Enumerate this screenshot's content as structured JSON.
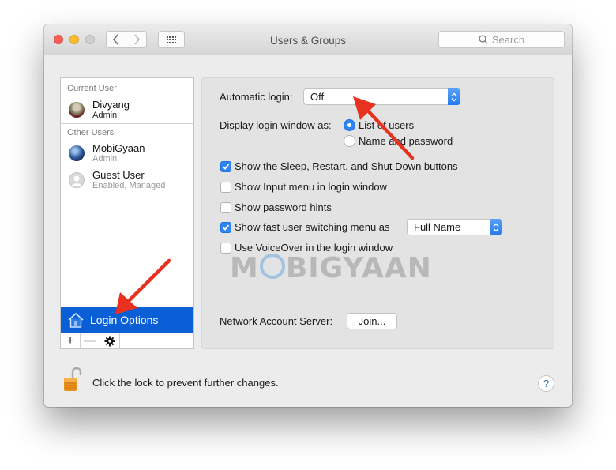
{
  "window": {
    "title": "Users & Groups",
    "search_placeholder": "Search",
    "icons": {
      "close": "close-icon",
      "minimize": "minimize-icon",
      "zoom": "zoom-icon",
      "back": "chevron-left-icon",
      "forward": "chevron-right-icon",
      "show_all": "grid-icon",
      "search": "search-icon"
    }
  },
  "sidebar": {
    "current_user_header": "Current User",
    "other_users_header": "Other Users",
    "current_user": {
      "name": "Divyang",
      "role": "Admin"
    },
    "other_users": [
      {
        "name": "MobiGyaan",
        "role": "Admin"
      },
      {
        "name": "Guest User",
        "role": "Enabled, Managed"
      }
    ],
    "login_options_label": "Login Options",
    "toolbar": {
      "add": "+",
      "remove": "—",
      "settings": "gear-icon"
    }
  },
  "login_options": {
    "automatic_login_label": "Automatic login:",
    "automatic_login_value": "Off",
    "display_login_label": "Display login window as:",
    "display_options": [
      {
        "label": "List of users",
        "selected": true
      },
      {
        "label": "Name and password",
        "selected": false
      }
    ],
    "checkboxes": [
      {
        "label": "Show the Sleep, Restart, and Shut Down buttons",
        "checked": true
      },
      {
        "label": "Show Input menu in login window",
        "checked": false
      },
      {
        "label": "Show password hints",
        "checked": false
      },
      {
        "label": "Show fast user switching menu as",
        "checked": true
      },
      {
        "label": "Use VoiceOver in the login window",
        "checked": false
      }
    ],
    "fast_switch_value": "Full Name",
    "network_server_label": "Network Account Server:",
    "join_button": "Join..."
  },
  "watermark": {
    "left": "M",
    "right": "BIGYAAN"
  },
  "footer": {
    "lock_text": "Click the lock to prevent further changes.",
    "help_label": "?"
  },
  "colors": {
    "accent": "#2e86f5",
    "selection": "#0a5fd6",
    "annotation_arrow": "#e8321f"
  }
}
